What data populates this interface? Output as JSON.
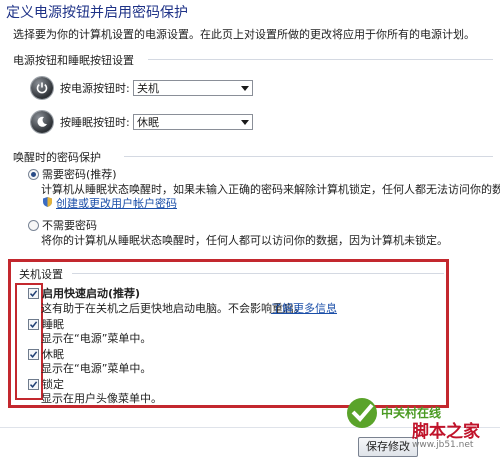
{
  "page": {
    "title": "定义电源按钮并启用密码保护",
    "subtitle": "选择要为你的计算机设置的电源设置。在此页上对设置所做的更改将应用于你所有的电源计划。"
  },
  "power_buttons": {
    "group_label": "电源按钮和睡眠按钮设置",
    "rows": [
      {
        "label": "按电源按钮时:",
        "value": "关机",
        "icon": "power-icon"
      },
      {
        "label": "按睡眠按钮时:",
        "value": "休眠",
        "icon": "moon-icon"
      }
    ]
  },
  "password": {
    "group_label": "唤醒时的密码保护",
    "option_required": {
      "label": "需要密码(推荐)",
      "desc": "计算机从睡眠状态唤醒时，如果未输入正确的密码来解除计算机锁定，任何人都无法访问你的数据。",
      "link": "创建或更改用户帐户密码"
    },
    "option_not_required": {
      "label": "不需要密码",
      "desc": "将你的计算机从睡眠状态唤醒时，任何人都可以访问你的数据，因为计算机未锁定。"
    }
  },
  "shutdown": {
    "group_label": "关机设置",
    "items": [
      {
        "label": "启用快速启动(推荐)",
        "desc": "这有助于在关机之后更快地启动电脑。不会影响重启。",
        "link": "了解更多信息",
        "checked": true
      },
      {
        "label": "睡眠",
        "desc": "显示在“电源”菜单中。",
        "checked": true
      },
      {
        "label": "休眠",
        "desc": "显示在“电源”菜单中。",
        "checked": true
      },
      {
        "label": "锁定",
        "desc": "显示在用户头像菜单中。",
        "checked": true
      }
    ]
  },
  "footer": {
    "save_label": "保存修改"
  },
  "watermarks": {
    "site_a": "中关村在线",
    "site_b": "脚本之家",
    "site_b_url": "www.jb51.net"
  },
  "colors": {
    "title_blue": "#1e3287",
    "link_blue": "#1a4ea8",
    "highlight_red": "#c3282e"
  }
}
